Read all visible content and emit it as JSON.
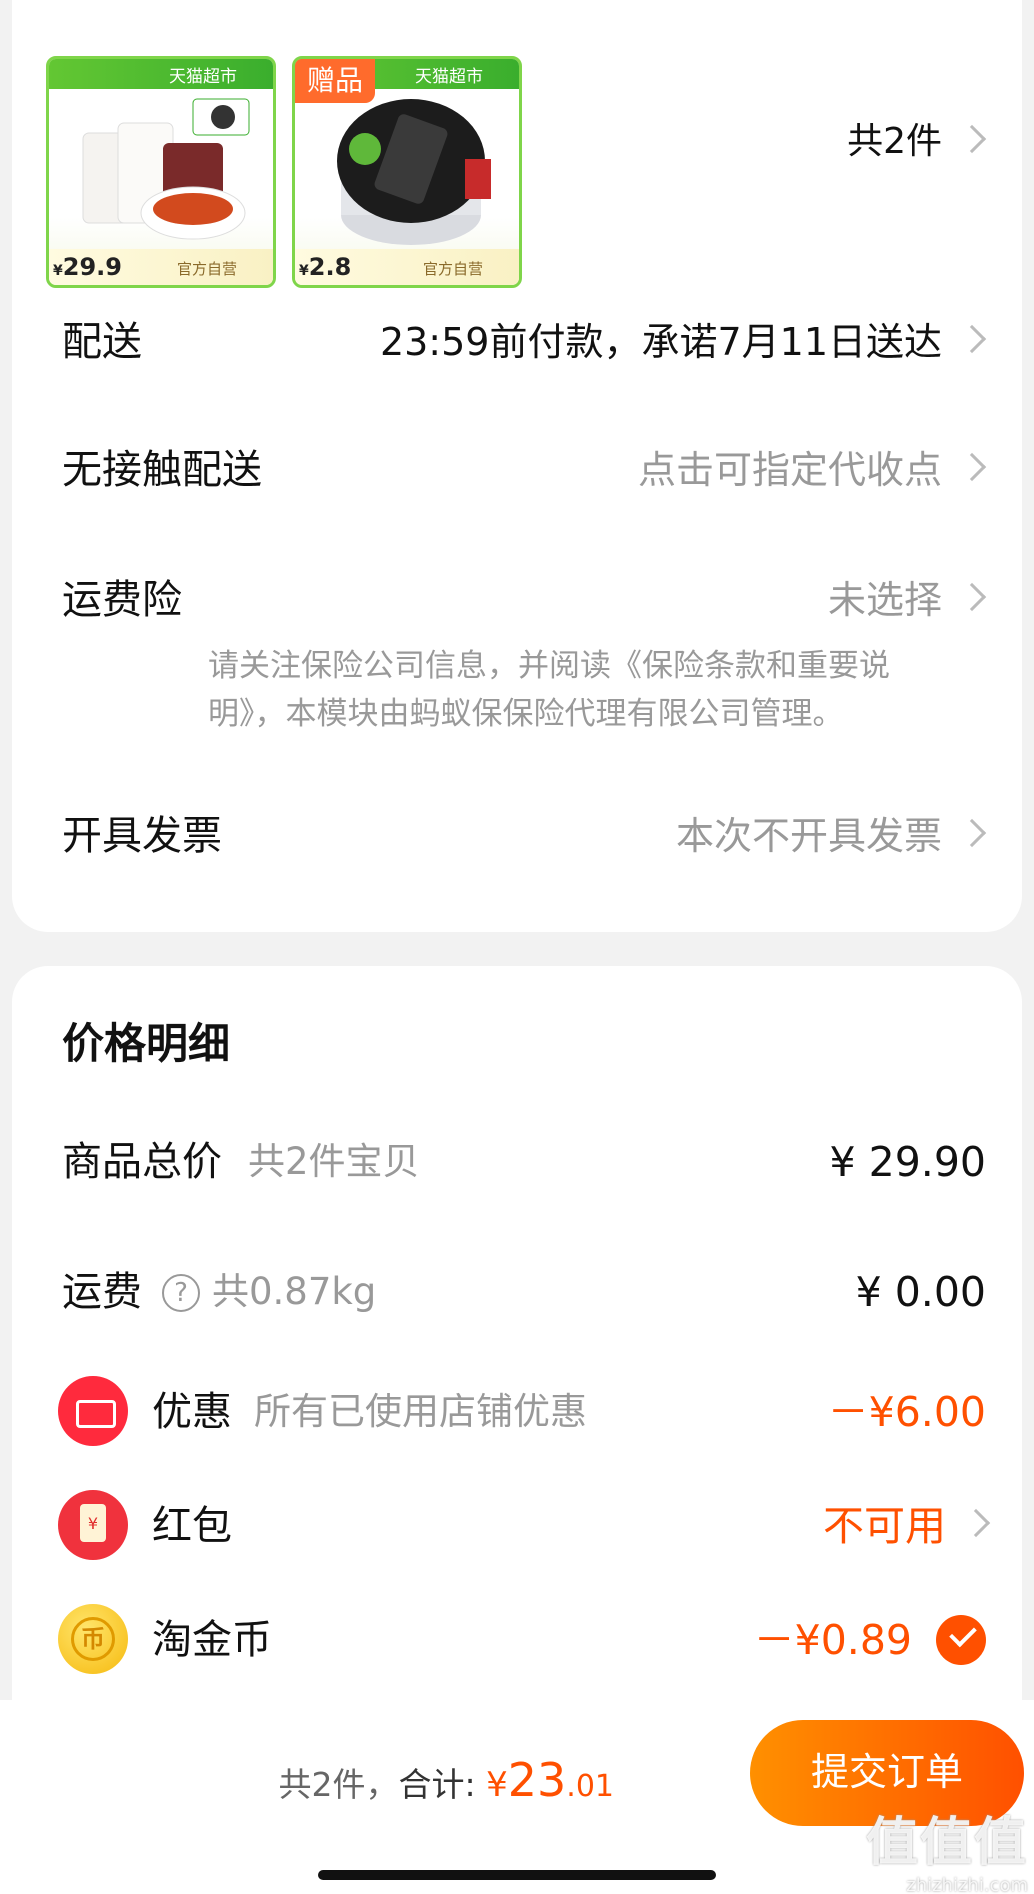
{
  "products": {
    "count_label": "共2件",
    "items": [
      {
        "store_tag": "天猫超市",
        "price_currency": "¥",
        "price": "29.9",
        "self_operated": "官方自营",
        "gift": ""
      },
      {
        "store_tag": "天猫超市",
        "price_currency": "¥",
        "price": "2.8",
        "self_operated": "官方自营",
        "gift": "赠品"
      }
    ]
  },
  "delivery": {
    "label": "配送",
    "value": "23:59前付款，承诺7月11日送达"
  },
  "contactless": {
    "label": "无接触配送",
    "value": "点击可指定代收点"
  },
  "shipping_insurance": {
    "label": "运费险",
    "value": "未选择",
    "note_line1": "请关注保险公司信息，并阅读《保险条款和重要说",
    "note_line2": "明》，本模块由蚂蚁保保险代理有限公司管理。"
  },
  "invoice": {
    "label": "开具发票",
    "value": "本次不开具发票"
  },
  "price_detail": {
    "title": "价格明细",
    "goods_total": {
      "label": "商品总价",
      "sub": "共2件宝贝",
      "amount": "¥ 29.90"
    },
    "shipping": {
      "label": "运费",
      "help": "?",
      "sub": "共0.87kg",
      "amount": "¥ 0.00"
    },
    "discount": {
      "label": "优惠",
      "sub": "所有已使用店铺优惠",
      "amount": "－¥6.00"
    },
    "red_packet": {
      "label": "红包",
      "icon_text": "¥",
      "amount": "不可用"
    },
    "taojinbi": {
      "label": "淘金币",
      "icon_text": "币",
      "amount": "－¥0.89"
    }
  },
  "footer": {
    "items_label": "共2件，",
    "total_label": "合计:",
    "currency": "¥",
    "total_int": "23",
    "total_dec": ".01",
    "submit_label": "提交订单",
    "watermark_big": "值值值",
    "watermark_small": "zhizhizhi.com"
  },
  "colors": {
    "accent": "#ff5000",
    "tmall_green": "#3ebf3a",
    "muted": "#999999"
  }
}
